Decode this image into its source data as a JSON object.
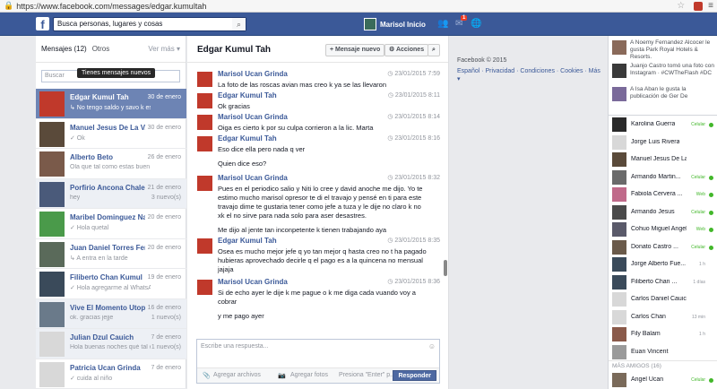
{
  "browser": {
    "url": "https://www.facebook.com/messages/edgar.kumultah"
  },
  "fb": {
    "logo": "f",
    "search_placeholder": "Busca personas, lugares y cosas",
    "user_name": "Marisol",
    "home_label": "Inicio",
    "notif_badge": "1"
  },
  "left": {
    "tab_messages": "Mensajes (12)",
    "tab_others": "Otros",
    "see_more": "Ver más ▾",
    "search_placeholder": "Buscar",
    "tooltip": "Tienes mensajes nuevos",
    "conversations": [
      {
        "name": "Edgar Kumul Tah",
        "date": "30 de enero",
        "snippet": "↳ No tengo saldo y savo k es un ...",
        "count": "",
        "selected": true,
        "color": "#c0392b"
      },
      {
        "name": "Manuel Jesus De La V...",
        "date": "30 de enero",
        "snippet": "✓ Ok",
        "count": "",
        "color": "#5a4a3a"
      },
      {
        "name": "Alberto Beto",
        "date": "26 de enero",
        "snippet": "Ola que tal como estas buen dia",
        "count": "",
        "color": "#7a5a4a"
      },
      {
        "name": "Porfirio Ancona Chale",
        "date": "21 de enero",
        "snippet": "hey",
        "count": "3 nuevo(s)",
        "unread": true,
        "color": "#4a5a7a"
      },
      {
        "name": "Maribel Dominguez Nah",
        "date": "20 de enero",
        "snippet": "✓ Hola quetal",
        "count": "",
        "color": "#4a9a4a"
      },
      {
        "name": "Juan Daniel Torres Fer...",
        "date": "20 de enero",
        "snippet": "↳ A entra en la tarde",
        "count": "",
        "color": "#5a6a5a"
      },
      {
        "name": "Filiberto Chan Kumul",
        "date": "19 de enero",
        "snippet": "✓ Hola agregarme al WhatsApp ...",
        "count": "",
        "color": "#3a4a5a"
      },
      {
        "name": "Vive El Momento Utopia",
        "date": "16 de enero",
        "snippet": "ok. gracias jejje",
        "count": "1 nuevo(s)",
        "unread": true,
        "color": "#6a7a8a"
      },
      {
        "name": "Julian Dzul Cauich",
        "date": "7 de enero",
        "snippet": "Hola buenas noches qué tal estas...",
        "count": "1 nuevo(s)",
        "unread": true,
        "color": "#d8d8d8"
      },
      {
        "name": "Patricia Ucan Grinda",
        "date": "7 de enero",
        "snippet": "✓ cuida al niño",
        "count": "",
        "color": "#d8d8d8"
      }
    ]
  },
  "chat": {
    "title": "Edgar Kumul Tah",
    "new_message": "+ Mensaje nuevo",
    "actions": "⚙ Acciones",
    "messages": [
      {
        "name": "Marisol Ucan Grinda",
        "time": "◷ 23/01/2015 7:59",
        "lines": [
          "La foto de las roscas avian mas creo k ya se las llevaron"
        ],
        "color": "#c0392b"
      },
      {
        "name": "Edgar Kumul Tah",
        "time": "◷ 23/01/2015 8:11",
        "lines": [
          "Ok gracias"
        ],
        "color": "#c0392b"
      },
      {
        "name": "Marisol Ucan Grinda",
        "time": "◷ 23/01/2015 8:14",
        "lines": [
          "Oiga es cierto k por su culpa corrieron a la lic.  Marta"
        ],
        "color": "#c0392b"
      },
      {
        "name": "Edgar Kumul Tah",
        "time": "◷ 23/01/2015 8:16",
        "lines": [
          "Eso dice ella pero nada q ver",
          "Quien dice eso?"
        ],
        "color": "#c0392b"
      },
      {
        "name": "Marisol Ucan Grinda",
        "time": "◷ 23/01/2015 8:32",
        "lines": [
          "Pues en el periodico salio y Niti lo cree y david anoche me dijo. Yo te estimo mucho marisol opresor te di el travajo y pensé en ti para este travajo dime te gustaria tener como jefe a tuza y le dije no claro k no xk el no sirve para nada solo para aser desastres.",
          "Me dijo al jente tan inconpetente k tienen trabajando aya"
        ],
        "color": "#c0392b"
      },
      {
        "name": "Edgar Kumul Tah",
        "time": "◷ 23/01/2015 8:35",
        "lines": [
          "Osea es mucho mejor jefe q yo tan mejor q hasta creo no t ha pagado hubieras aprovechado decirle q el pago es a la quincena no mensual jajaja"
        ],
        "color": "#c0392b"
      },
      {
        "name": "Marisol Ucan Grinda",
        "time": "◷ 23/01/2015 8:36",
        "lines": [
          "Si de echo ayer le dije k me pague o k me diga cada vuando voy a cobrar",
          "y me pago ayer"
        ],
        "color": "#c0392b"
      }
    ],
    "composer": {
      "placeholder": "Escribe una respuesta...",
      "add_files": "Agregar archivos",
      "add_photos": "Agregar fotos",
      "enter_hint": "Presiona \"Enter\" p...",
      "reply": "Responder"
    }
  },
  "rside": {
    "copyright": "Facebook © 2015",
    "links": "Español · Privacidad · Condiciones · Cookies · Más ▾"
  },
  "ticker": {
    "items": [
      {
        "text": "A Noemy Fernandez Alcocer le gusta Park Royal Hotels & Resorts.",
        "color": "#8a6a5a"
      },
      {
        "text": "Juanjo Castro tomó una foto con Instagram · #CWTheFlash #DC",
        "color": "#3a3a3a"
      },
      {
        "text": "A Isa Aban le gusta la publicación de Ger De",
        "color": "#7a6a9a"
      }
    ],
    "friends": [
      {
        "name": "Karolina Guerra",
        "status": "Celular",
        "color": "#2a2a2a"
      },
      {
        "name": "Jorge Luis Rivera",
        "status": "",
        "color": "#d8d8d8"
      },
      {
        "name": "Manuel Jesus De La V...",
        "status": "",
        "color": "#5a4a3a"
      },
      {
        "name": "Armando Martin...",
        "status": "Celular",
        "color": "#6a6a6a"
      },
      {
        "name": "Fabiola Cervera ...",
        "status": "Web",
        "color": "#c06a8a"
      },
      {
        "name": "Armando Jesus",
        "status": "Celular",
        "color": "#4a4a4a"
      },
      {
        "name": "Cohuo Miguel Angel",
        "status": "Web",
        "color": "#5a5a6a"
      },
      {
        "name": "Donato Castro ...",
        "status": "Celular",
        "color": "#6a5a4a"
      },
      {
        "name": "Jorge Alberto Fue...",
        "status": "1 h",
        "color": "#3a4a5a"
      },
      {
        "name": "Filiberto Chan ...",
        "status": "1 días",
        "color": "#3a4a5a"
      },
      {
        "name": "Carlos Daniel Cauich",
        "status": "",
        "color": "#d8d8d8"
      },
      {
        "name": "Carlos Chan",
        "status": "13 min",
        "color": "#d8d8d8"
      },
      {
        "name": "Fily Balam",
        "status": "1 h",
        "color": "#8a5a4a"
      },
      {
        "name": "Euan Vincent",
        "status": "",
        "color": "#9a9a9a"
      }
    ],
    "more_friends": "MÁS AMIGOS (16)",
    "last_friend": {
      "name": "Angel Ucan",
      "status": "Celular"
    }
  }
}
